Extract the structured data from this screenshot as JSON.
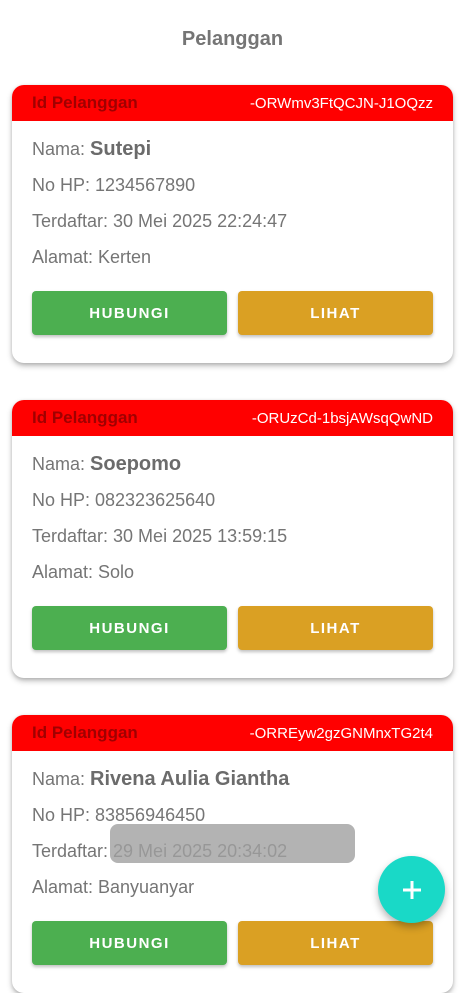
{
  "page": {
    "title": "Pelanggan"
  },
  "customers": [
    {
      "header_label": "Id Pelanggan",
      "id": "-ORWmv3FtQCJN-J1OQzz",
      "name_label": "Nama: ",
      "name": "Sutepi",
      "phone": "No HP: 1234567890",
      "registered": "Terdaftar: 30 Mei 2025 22:24:47",
      "address": "Alamat: Kerten",
      "contact_button": "HUBUNGI",
      "view_button": "LIHAT"
    },
    {
      "header_label": "Id Pelanggan",
      "id": "-ORUzCd-1bsjAWsqQwND",
      "name_label": "Nama: ",
      "name": "Soepomo",
      "phone": "No HP: 082323625640",
      "registered": "Terdaftar: 30 Mei 2025 13:59:15",
      "address": "Alamat: Solo",
      "contact_button": "HUBUNGI",
      "view_button": "LIHAT"
    },
    {
      "header_label": "Id Pelanggan",
      "id": "-ORREyw2gzGNMnxTG2t4",
      "name_label": "Nama: ",
      "name": "Rivena Aulia Giantha",
      "phone": "No HP: 83856946450",
      "registered": "Terdaftar: 29 Mei 2025 20:34:02",
      "address": "Alamat: Banyuanyar",
      "contact_button": "HUBUNGI",
      "view_button": "LIHAT"
    }
  ],
  "fab": {
    "icon": "plus-icon",
    "color": "#19d9c7"
  },
  "colors": {
    "header": "#ff0000",
    "contact": "#4caf50",
    "view": "#daa023"
  }
}
